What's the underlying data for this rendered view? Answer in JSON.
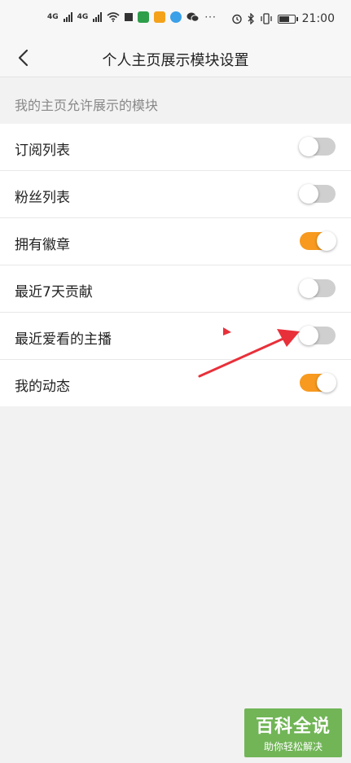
{
  "status_bar": {
    "network_1": "4G",
    "network_2": "4G",
    "time": "21:00",
    "app_icon_colors": [
      "#2e9e4a",
      "#f4a21a",
      "#3aa0e8"
    ],
    "icons": [
      "signal-icon",
      "wifi-icon",
      "app-icon",
      "app-icon",
      "app-icon",
      "wechat-icon",
      "more-icon",
      "alarm-icon",
      "bluetooth-icon",
      "vibrate-icon",
      "battery-icon"
    ]
  },
  "header": {
    "title": "个人主页展示模块设置",
    "back_icon": "chevron-left-icon"
  },
  "section": {
    "label": "我的主页允许展示的模块"
  },
  "modules": [
    {
      "label": "订阅列表",
      "on": false
    },
    {
      "label": "粉丝列表",
      "on": false
    },
    {
      "label": "拥有徽章",
      "on": true
    },
    {
      "label": "最近7天贡献",
      "on": false
    },
    {
      "label": "最近爱看的主播",
      "on": false
    },
    {
      "label": "我的动态",
      "on": true
    }
  ],
  "colors": {
    "toggle_on": "#f79a1f",
    "toggle_off": "#cfcfcf",
    "annotation_arrow": "#e8303a"
  },
  "watermark": {
    "title": "百科全说",
    "subtitle": "助你轻松解决"
  }
}
